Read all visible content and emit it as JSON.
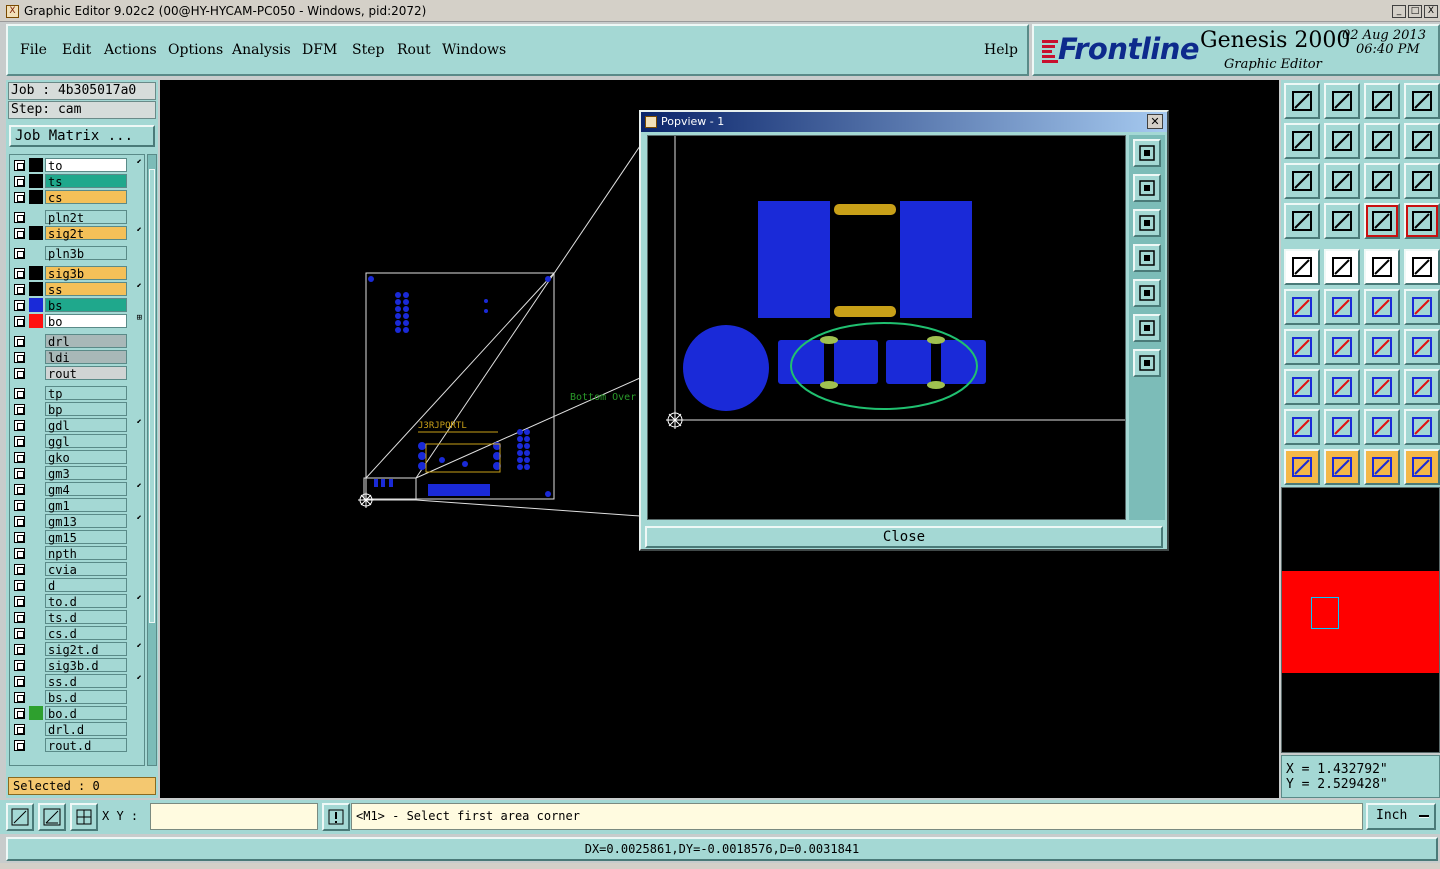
{
  "window": {
    "title": "Graphic Editor 9.02c2 (00@HY-HYCAM-PC050 - Windows, pid:2072)",
    "controls": [
      "_",
      "□",
      "X"
    ]
  },
  "menu": {
    "items": [
      "File",
      "Edit",
      "Actions",
      "Options",
      "Analysis",
      "DFM",
      "Step",
      "Rout",
      "Windows"
    ],
    "help": "Help"
  },
  "brand": {
    "company": "Frontline",
    "product": "Genesis 2000",
    "subtitle": "Graphic Editor",
    "date": "02  Aug  2013",
    "time": "06:40  PM"
  },
  "job": {
    "job_label": "Job : 4b305017a0",
    "step_label": "Step: cam",
    "matrix_button": "Job Matrix ..."
  },
  "layers": [
    {
      "name": "to",
      "color": "#ffffff",
      "swatch": "#000000",
      "mark": "⬋"
    },
    {
      "name": "ts",
      "color": "#1fa88c",
      "swatch": "#000000",
      "mark": ""
    },
    {
      "name": "cs",
      "color": "#f4c058",
      "swatch": "#000000",
      "mark": ""
    },
    {
      "name": "pln2t",
      "color": "#a4d8d4",
      "swatch": "",
      "mark": ""
    },
    {
      "name": "sig2t",
      "color": "#f4c058",
      "swatch": "#000000",
      "mark": "⬋"
    },
    {
      "name": "pln3b",
      "color": "#a4d8d4",
      "swatch": "",
      "mark": ""
    },
    {
      "name": "sig3b",
      "color": "#f4c058",
      "swatch": "#000000",
      "mark": ""
    },
    {
      "name": "ss",
      "color": "#f4c058",
      "swatch": "#000000",
      "mark": "⬋"
    },
    {
      "name": "bs",
      "color": "#1fa88c",
      "swatch": "#1a2ad8",
      "mark": ""
    },
    {
      "name": "bo",
      "color": "#ffffff",
      "swatch": "#ff1010",
      "mark": "⊞"
    },
    {
      "name": "drl",
      "color": "#a8b8b8",
      "swatch": "",
      "mark": ""
    },
    {
      "name": "ldi",
      "color": "#a8b8b8",
      "swatch": "",
      "mark": ""
    },
    {
      "name": "rout",
      "color": "#d0d4d4",
      "swatch": "",
      "mark": ""
    },
    {
      "name": "tp",
      "color": "#a4d8d4",
      "swatch": "",
      "mark": ""
    },
    {
      "name": "bp",
      "color": "#a4d8d4",
      "swatch": "",
      "mark": ""
    },
    {
      "name": "gdl",
      "color": "#a4d8d4",
      "swatch": "",
      "mark": "⬋"
    },
    {
      "name": "ggl",
      "color": "#a4d8d4",
      "swatch": "",
      "mark": ""
    },
    {
      "name": "gko",
      "color": "#a4d8d4",
      "swatch": "",
      "mark": ""
    },
    {
      "name": "gm3",
      "color": "#a4d8d4",
      "swatch": "",
      "mark": ""
    },
    {
      "name": "gm4",
      "color": "#a4d8d4",
      "swatch": "",
      "mark": "⬋"
    },
    {
      "name": "gm1",
      "color": "#a4d8d4",
      "swatch": "",
      "mark": ""
    },
    {
      "name": "gm13",
      "color": "#a4d8d4",
      "swatch": "",
      "mark": "⬋"
    },
    {
      "name": "gm15",
      "color": "#a4d8d4",
      "swatch": "",
      "mark": ""
    },
    {
      "name": "npth",
      "color": "#a4d8d4",
      "swatch": "",
      "mark": ""
    },
    {
      "name": "cvia",
      "color": "#a4d8d4",
      "swatch": "",
      "mark": ""
    },
    {
      "name": "d",
      "color": "#a4d8d4",
      "swatch": "",
      "mark": ""
    },
    {
      "name": "to.d",
      "color": "#a4d8d4",
      "swatch": "",
      "mark": "⬋"
    },
    {
      "name": "ts.d",
      "color": "#a4d8d4",
      "swatch": "",
      "mark": ""
    },
    {
      "name": "cs.d",
      "color": "#a4d8d4",
      "swatch": "",
      "mark": ""
    },
    {
      "name": "sig2t.d",
      "color": "#a4d8d4",
      "swatch": "",
      "mark": "⬋"
    },
    {
      "name": "sig3b.d",
      "color": "#a4d8d4",
      "swatch": "",
      "mark": ""
    },
    {
      "name": "ss.d",
      "color": "#a4d8d4",
      "swatch": "",
      "mark": "⬋"
    },
    {
      "name": "bs.d",
      "color": "#a4d8d4",
      "swatch": "",
      "mark": ""
    },
    {
      "name": "bo.d",
      "color": "#a4d8d4",
      "swatch": "#2ea02e",
      "mark": ""
    },
    {
      "name": "drl.d",
      "color": "#a4d8d4",
      "swatch": "",
      "mark": ""
    },
    {
      "name": "rout.d",
      "color": "#a4d8d4",
      "swatch": "",
      "mark": ""
    }
  ],
  "selected": "Selected : 0",
  "canvas": {
    "overlay_label": "Bottom Over",
    "silk_label": "J3RJPQRTL"
  },
  "popview": {
    "title": "Popview - 1",
    "close_label": "Close"
  },
  "coords": {
    "x": "X = 1.432792\"",
    "y": "Y = 2.529428\""
  },
  "bottom": {
    "xy_label": "X Y :",
    "xy_value": "",
    "message": "<M1> - Select first area corner",
    "unit": "Inch"
  },
  "status": "DX=0.0025861,DY=-0.0018576,D=0.0031841",
  "colors": {
    "panel": "#a4d8d4",
    "pad_blue": "#1a2ad8",
    "pad_gold": "#c8a018",
    "highlight_green": "#20c070",
    "overview_red": "#ff0000"
  }
}
